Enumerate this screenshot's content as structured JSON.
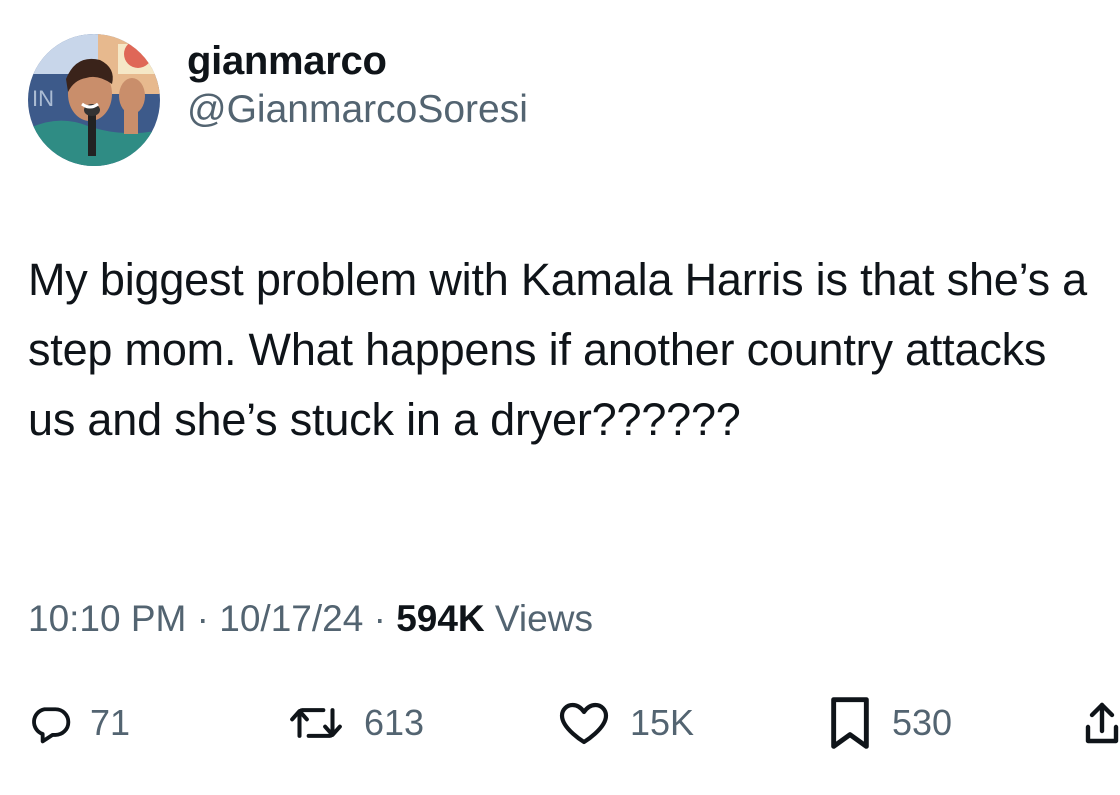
{
  "author": {
    "display_name": "gianmarco",
    "handle": "@GianmarcoSoresi",
    "avatar_icon": "profile-photo"
  },
  "tweet": {
    "text": "My biggest problem with Kamala Harris is that she’s a step mom. What happens if another country attacks us and she’s stuck in a dryer??????"
  },
  "meta": {
    "time": "10:10 PM",
    "date": "10/17/24",
    "separator": "·",
    "views_count": "594K",
    "views_label": "Views"
  },
  "actions": {
    "replies": "71",
    "reposts": "613",
    "likes": "15K",
    "bookmarks": "530",
    "reply_icon": "reply-icon",
    "repost_icon": "repost-icon",
    "like_icon": "heart-icon",
    "bookmark_icon": "bookmark-icon",
    "share_icon": "share-icon"
  },
  "colors": {
    "text_primary": "#0f1419",
    "text_secondary": "#536471",
    "background": "#ffffff"
  }
}
